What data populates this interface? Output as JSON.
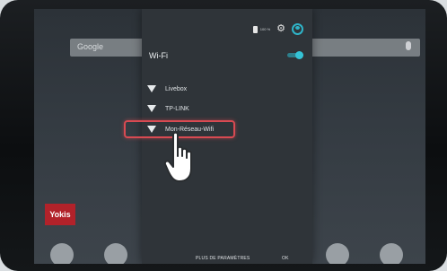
{
  "home": {
    "search_placeholder": "Google",
    "promo_label": "Yokis"
  },
  "quick_settings": {
    "battery_pct": "100 %"
  },
  "wifi": {
    "title": "Wi-Fi",
    "enabled": true,
    "networks": [
      {
        "name": "Livebox"
      },
      {
        "name": "TP-LINK"
      },
      {
        "name": "Mon-Réseau-Wifi",
        "selected": true
      }
    ]
  },
  "actions": {
    "more_settings_label": "PLUS DE PARAMÈTRES",
    "ok_label": "OK"
  },
  "colors": {
    "accent": "#35c3d6",
    "highlight": "#d84a52"
  }
}
